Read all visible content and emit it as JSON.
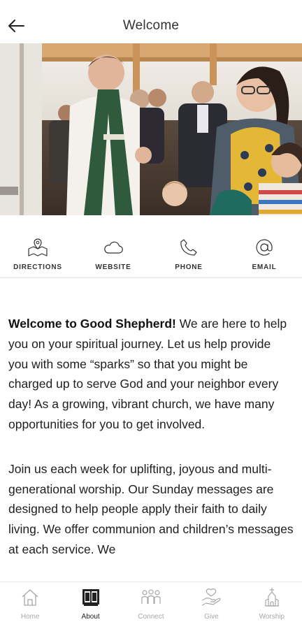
{
  "header": {
    "title": "Welcome"
  },
  "actions": [
    {
      "label": "DIRECTIONS",
      "icon": "map-pin-icon"
    },
    {
      "label": "WEBSITE",
      "icon": "cloud-icon"
    },
    {
      "label": "PHONE",
      "icon": "phone-icon"
    },
    {
      "label": "EMAIL",
      "icon": "at-sign-icon"
    }
  ],
  "content": {
    "intro_bold": "Welcome to Good Shepherd!",
    "intro_rest": " We are here to help you on your spiritual journey. Let us help provide you with some “sparks” so that you might be charged up to serve God and your neighbor every day! As a growing, vibrant church, we have many opportunities for you to get involved.",
    "paragraph2": "Join us each week for uplifting, joyous and multi-generational worship. Our Sunday messages are designed to help people apply their faith to daily living. We offer communion and children’s messages at each service. We"
  },
  "tabs": [
    {
      "label": "Home",
      "icon": "home-icon",
      "active": false
    },
    {
      "label": "About",
      "icon": "book-icon",
      "active": true
    },
    {
      "label": "Connect",
      "icon": "people-icon",
      "active": false
    },
    {
      "label": "Give",
      "icon": "giving-hand-icon",
      "active": false
    },
    {
      "label": "Worship",
      "icon": "church-icon",
      "active": false
    }
  ],
  "colors": {
    "inactive_tab": "#a8a8a8",
    "active_tab": "#222222",
    "divider": "#e4e4e4"
  }
}
